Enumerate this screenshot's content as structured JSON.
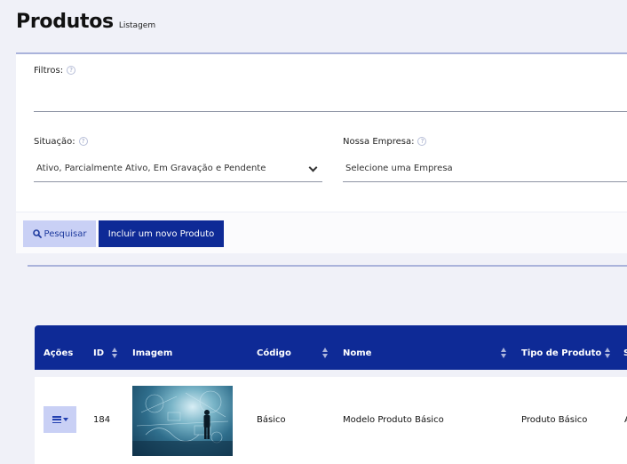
{
  "header": {
    "title": "Produtos",
    "subtitle": "Listagem"
  },
  "filters": {
    "label": "Filtros:",
    "value": "",
    "situacao": {
      "label": "Situação:",
      "value": "Ativo, Parcialmente Ativo, Em Gravação e Pendente"
    },
    "empresa": {
      "label": "Nossa Empresa:",
      "placeholder": "Selecione uma Empresa"
    },
    "help_glyph": "?"
  },
  "actions": {
    "search_label": "Pesquisar",
    "add_label": "Incluir um novo Produto"
  },
  "table": {
    "columns": {
      "acoes": "Ações",
      "id": "ID",
      "imagem": "Imagem",
      "codigo": "Código",
      "nome": "Nome",
      "tipo": "Tipo de Produto",
      "next": "S"
    },
    "rows": [
      {
        "id": "184",
        "codigo": "Básico",
        "nome": "Modelo Produto Básico",
        "tipo": "Produto Básico",
        "next": "A"
      }
    ]
  },
  "colors": {
    "primary": "#0e2a96",
    "secondary": "#c9d0f5",
    "background": "#f0f1f8",
    "accent_line": "#aab3db"
  },
  "icons": {
    "search": "search-icon",
    "help": "help-icon",
    "sort": "sort-icon",
    "actions_menu": "list-icon",
    "select": "chevron-down-icon"
  }
}
